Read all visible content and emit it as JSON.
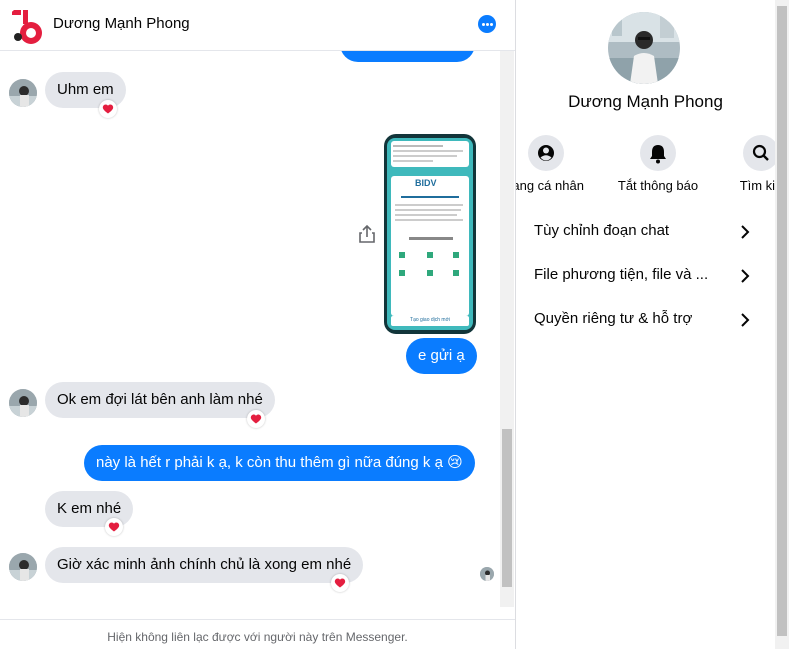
{
  "header": {
    "contact_name": "Dương Mạnh Phong"
  },
  "messages": {
    "m1": "Uhm em",
    "m2": "e gửi ạ",
    "m3": "Ok em đợi lát bên anh làm nhé",
    "m4": "này là hết r phải k ạ, k còn thu thêm gì nữa đúng k ạ 😢",
    "m5": "K em nhé",
    "m6": "Giờ xác minh ảnh chính chủ là xong em nhé"
  },
  "reactions": {
    "heart": "heart-icon"
  },
  "image_attachment": {
    "brand": "BIDV",
    "button": "Tạo giao dịch mới"
  },
  "footer": {
    "notice": "Hiện không liên lạc được với người này trên Messenger."
  },
  "profile": {
    "name": "Dương Mạnh Phong",
    "actions": [
      {
        "label": "rang cá nhân",
        "icon": "profile-icon"
      },
      {
        "label": "Tắt thông báo",
        "icon": "bell-icon"
      },
      {
        "label": "Tìm kiế",
        "icon": "search-icon"
      }
    ],
    "menu": [
      {
        "label": "Tùy chỉnh đoạn chat"
      },
      {
        "label": "File phương tiện, file và ..."
      },
      {
        "label": "Quyền riêng tư & hỗ trợ"
      }
    ]
  },
  "colors": {
    "accent": "#0a7cff",
    "incoming_bubble": "#e4e6eb",
    "heart": "#e41e3f"
  }
}
